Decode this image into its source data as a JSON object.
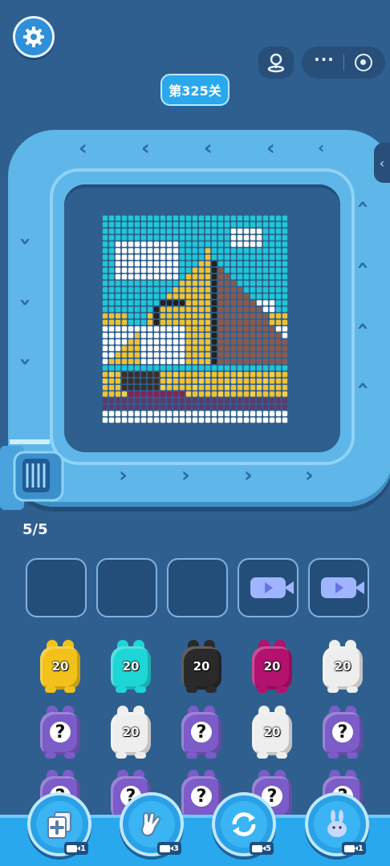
{
  "header": {
    "level_label": "第325关"
  },
  "progress": {
    "text": "5/5"
  },
  "slots": [
    {
      "state": "empty"
    },
    {
      "state": "empty"
    },
    {
      "state": "empty"
    },
    {
      "state": "video-locked",
      "icon": "video-camera-icon"
    },
    {
      "state": "video-locked",
      "icon": "video-camera-icon"
    }
  ],
  "characters": [
    [
      {
        "color": "#f2c21a",
        "label": "20"
      },
      {
        "color": "#1fd6d6",
        "label": "20"
      },
      {
        "color": "#2a2a2a",
        "label": "20"
      },
      {
        "color": "#b3126e",
        "label": "20"
      },
      {
        "color": "#eeeeee",
        "label": "20"
      }
    ],
    [
      {
        "color": "#7b5cc8",
        "label": "?"
      },
      {
        "color": "#eeeeee",
        "label": "20"
      },
      {
        "color": "#7b5cc8",
        "label": "?"
      },
      {
        "color": "#eeeeee",
        "label": "20"
      },
      {
        "color": "#7b5cc8",
        "label": "?"
      }
    ],
    [
      {
        "color": "#7b5cc8",
        "label": "?"
      },
      {
        "color": "#7b5cc8",
        "label": "?"
      },
      {
        "color": "#7b5cc8",
        "label": "?"
      },
      {
        "color": "#7b5cc8",
        "label": "?"
      },
      {
        "color": "#7b5cc8",
        "label": "?"
      }
    ]
  ],
  "tools": [
    {
      "name": "add-slot-tool",
      "icon": "card-plus-icon",
      "count": "1"
    },
    {
      "name": "hand-tool",
      "icon": "glove-hand-icon",
      "count": "3"
    },
    {
      "name": "shuffle-tool",
      "icon": "refresh-icon",
      "count": "5"
    },
    {
      "name": "magic-tool",
      "icon": "bunny-icon",
      "count": "1"
    }
  ],
  "colors": {
    "accent": "#2aa8ee",
    "background": "#2f5f8f",
    "track": "#5fb6e8"
  }
}
